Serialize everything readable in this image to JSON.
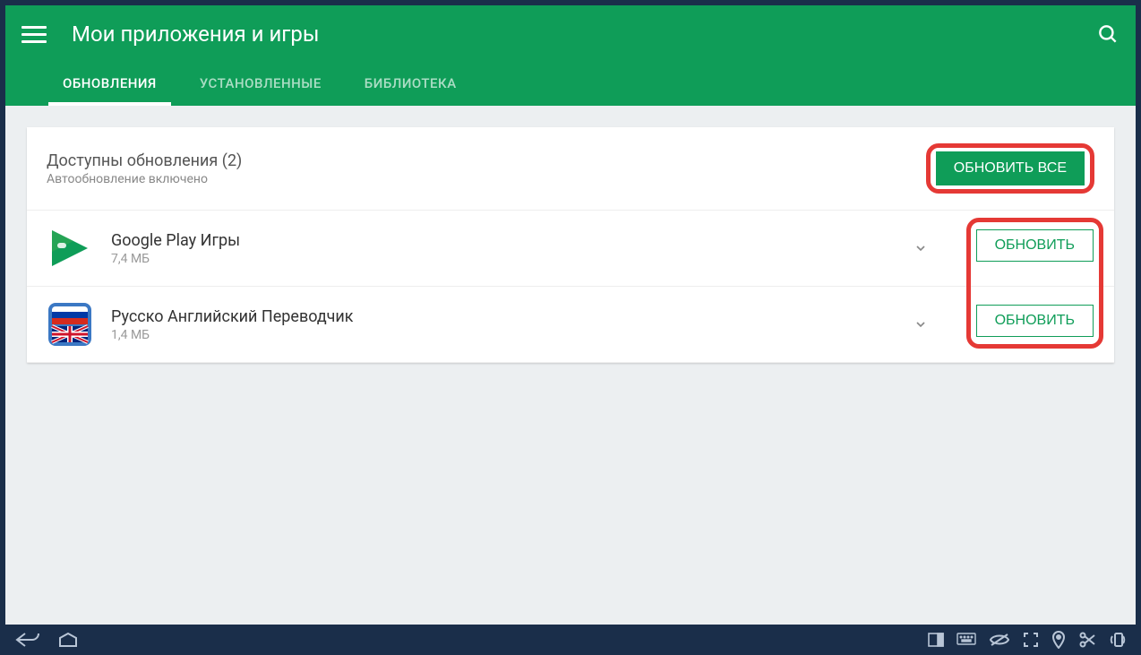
{
  "header": {
    "title": "Мои приложения и игры"
  },
  "tabs": [
    {
      "label": "ОБНОВЛЕНИЯ",
      "active": true
    },
    {
      "label": "УСТАНОВЛЕННЫЕ",
      "active": false
    },
    {
      "label": "БИБЛИОТЕКА",
      "active": false
    }
  ],
  "updates": {
    "section_title": "Доступны обновления (2)",
    "section_sub": "Автообновление включено",
    "update_all_label": "ОБНОВИТЬ ВСЕ",
    "item_button_label": "ОБНОВИТЬ",
    "items": [
      {
        "name": "Google Play Игры",
        "size": "7,4 МБ",
        "icon": "play-games"
      },
      {
        "name": "Русско Английский Переводчик",
        "size": "1,4 МБ",
        "icon": "ru-en-translator"
      }
    ]
  },
  "colors": {
    "accent": "#0f9d58",
    "highlight": "#e53935",
    "nav": "#1a2e4a"
  }
}
